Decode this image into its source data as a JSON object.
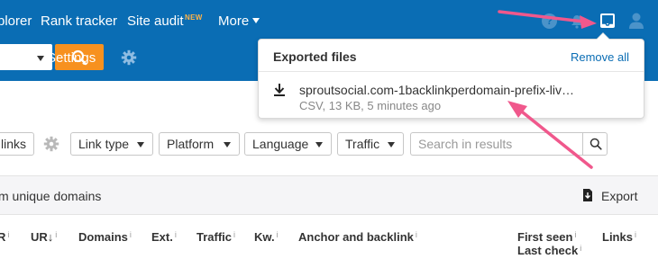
{
  "topnav": {
    "items": [
      "plorer",
      "Rank tracker",
      "Site audit",
      "More"
    ],
    "new_badge": "NEW",
    "help_symbol": "?",
    "icons": [
      "help-icon",
      "bell-icon",
      "inbox-icon",
      "user-icon"
    ]
  },
  "subbar": {
    "settings_label": "Settings",
    "icons": [
      "chevron-down-icon",
      "search-icon",
      "gear-icon"
    ]
  },
  "filters": {
    "links_label": "links",
    "link_type": "Link type",
    "platform": "Platform",
    "language": "Language",
    "traffic": "Traffic",
    "search_placeholder": "Search in results"
  },
  "infobar": {
    "text": "m unique domains",
    "export_label": "Export"
  },
  "table": {
    "columns": [
      "R",
      "UR",
      "Domains",
      "Ext.",
      "Traffic",
      "Kw.",
      "Anchor and backlink",
      "First seen",
      "Last check",
      "Links"
    ],
    "info_mark": "i",
    "sort_mark": "↓"
  },
  "export_panel": {
    "title": "Exported files",
    "remove_all": "Remove all",
    "files": [
      {
        "name": "sproutsocial.com-1backlinkperdomain-prefix-liv…",
        "meta": "CSV, 13 KB, 5 minutes ago"
      }
    ]
  },
  "colors": {
    "brand_blue": "#0a6db4",
    "accent_orange": "#f7911f",
    "badge_orange": "#ffb347",
    "annotation_pink": "#f0588c"
  }
}
